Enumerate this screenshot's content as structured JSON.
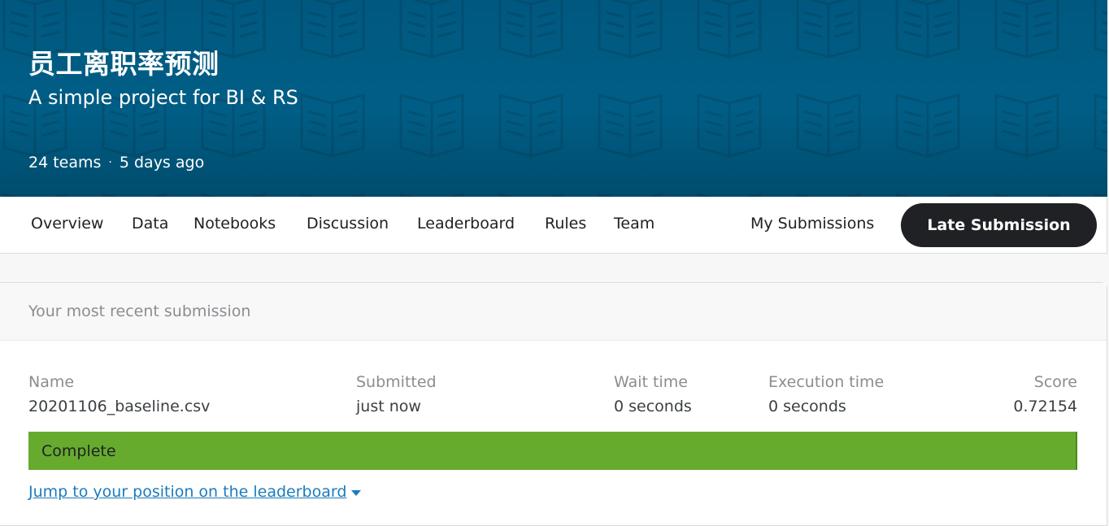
{
  "banner": {
    "title": "员工离职率预测",
    "subtitle": "A simple project for BI & RS",
    "teams": "24 teams",
    "separator": "·",
    "age": "5 days ago",
    "pattern_icon": "book-icon",
    "background_color": "#005e86"
  },
  "nav": {
    "tabs": [
      {
        "label": "Overview"
      },
      {
        "label": "Data"
      },
      {
        "label": "Notebooks"
      },
      {
        "label": "Discussion"
      },
      {
        "label": "Leaderboard"
      },
      {
        "label": "Rules"
      },
      {
        "label": "Team"
      }
    ],
    "my_submissions": "My Submissions",
    "late_submission": "Late Submission"
  },
  "submission": {
    "header": "Your most recent submission",
    "columns": {
      "name": {
        "label": "Name",
        "value": "20201106_baseline.csv"
      },
      "submitted": {
        "label": "Submitted",
        "value": "just now"
      },
      "wait_time": {
        "label": "Wait time",
        "value": "0 seconds"
      },
      "execution_time": {
        "label": "Execution time",
        "value": "0 seconds"
      },
      "score": {
        "label": "Score",
        "value": "0.72154"
      }
    },
    "status": "Complete",
    "status_color": "#66ab2e",
    "jump_link": "Jump to your position on the leaderboard"
  }
}
